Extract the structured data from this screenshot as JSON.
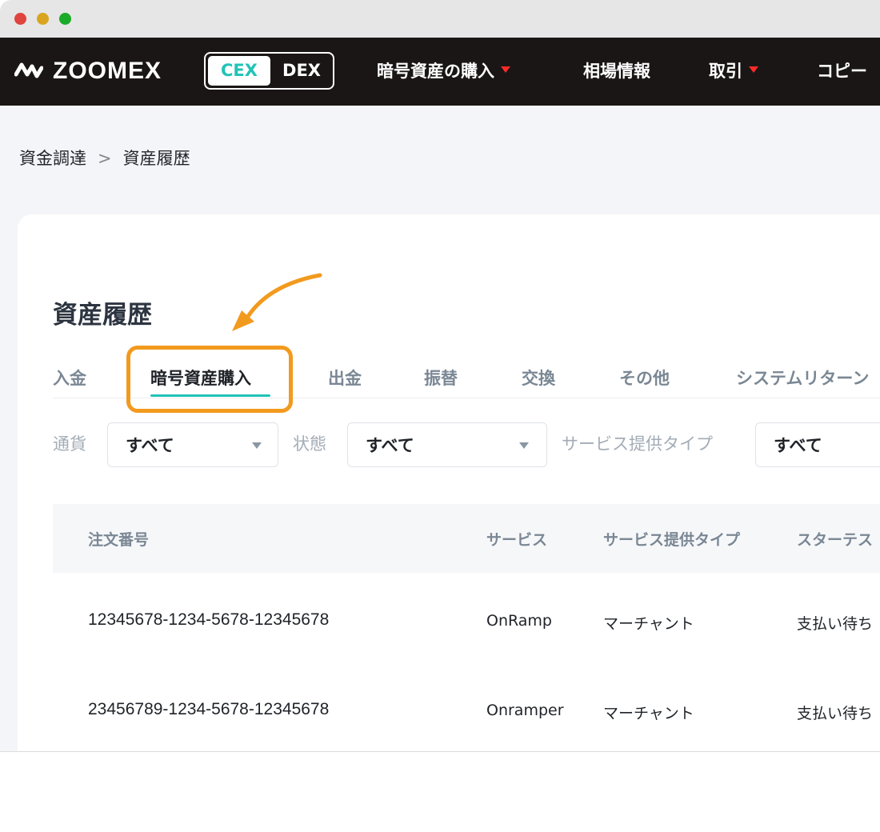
{
  "brand": {
    "name": "ZOOMEX",
    "accent": "#22c3b7",
    "highlight": "#f29a1e",
    "nav_bg": "#1b1616"
  },
  "mode_switch": {
    "cex": "CEX",
    "dex": "DEX"
  },
  "nav": [
    {
      "label": "暗号資産の購入",
      "dropdown": true
    },
    {
      "label": "相場情報",
      "dropdown": false
    },
    {
      "label": "取引",
      "dropdown": true
    },
    {
      "label": "コピー",
      "dropdown": false
    }
  ],
  "breadcrumb": {
    "parent": "資金調達",
    "separator": ">",
    "current": "資産履歴"
  },
  "page": {
    "title": "資産履歴"
  },
  "tabs": [
    {
      "label": "入金"
    },
    {
      "label": "暗号資産購入",
      "active": true
    },
    {
      "label": "出金"
    },
    {
      "label": "振替"
    },
    {
      "label": "交換"
    },
    {
      "label": "その他"
    },
    {
      "label": "システムリターン"
    }
  ],
  "filters": [
    {
      "label": "通貨",
      "value": "すべて"
    },
    {
      "label": "状態",
      "value": "すべて"
    },
    {
      "label": "サービス提供タイプ",
      "value": "すべて"
    }
  ],
  "table": {
    "columns": [
      "注文番号",
      "サービス",
      "サービス提供タイプ",
      "スターテス"
    ],
    "rows": [
      {
        "order_id": "12345678-1234-5678-12345678",
        "service": "OnRamp",
        "provider_type": "マーチャント",
        "status": "支払い待ち"
      },
      {
        "order_id": "23456789-1234-5678-12345678",
        "service": "Onramper",
        "provider_type": "マーチャント",
        "status": "支払い待ち"
      }
    ]
  }
}
